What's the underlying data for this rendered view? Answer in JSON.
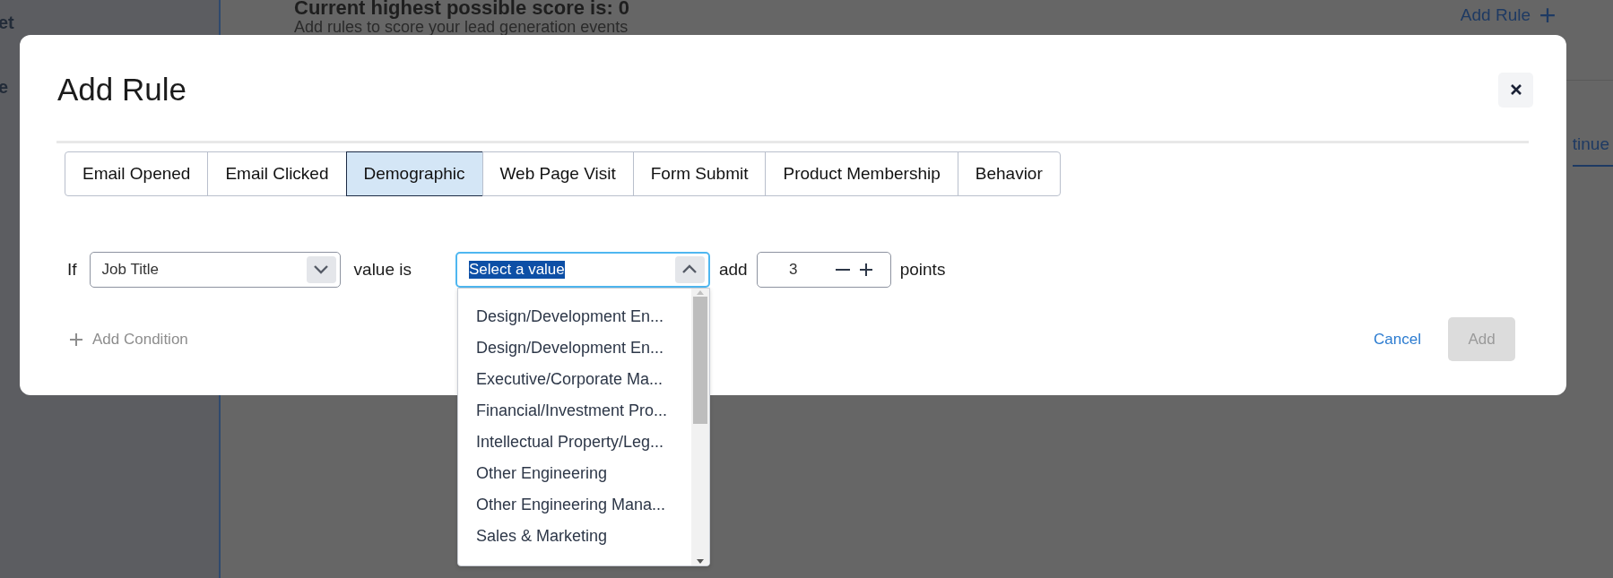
{
  "background": {
    "sidebar_items": [
      "et",
      "e"
    ],
    "heading": "Current highest possible score is: 0",
    "subheading": "Add rules to score your lead generation events",
    "add_rule_link": "Add Rule",
    "continue_button": "tinue"
  },
  "dialog": {
    "title": "Add Rule",
    "tabs": [
      {
        "label": "Email Opened",
        "selected": false
      },
      {
        "label": "Email Clicked",
        "selected": false
      },
      {
        "label": "Demographic",
        "selected": true
      },
      {
        "label": "Web Page Visit",
        "selected": false
      },
      {
        "label": "Form Submit",
        "selected": false
      },
      {
        "label": "Product Membership",
        "selected": false
      },
      {
        "label": "Behavior",
        "selected": false
      }
    ],
    "condition": {
      "if_label": "If",
      "field": {
        "value": "Job Title"
      },
      "operator_label": "value is",
      "value_select": {
        "value": "Select a value",
        "expanded": true,
        "options": [
          "Design/Development En...",
          "Design/Development En...",
          "Executive/Corporate Ma...",
          "Financial/Investment Pro...",
          "Intellectual Property/Leg...",
          "Other Engineering",
          "Other Engineering Mana...",
          "Sales & Marketing"
        ]
      },
      "add_label": "add",
      "points": {
        "value": "3"
      },
      "points_label": "points"
    },
    "add_condition": "Add Condition",
    "cancel": "Cancel",
    "add_button": {
      "label": "Add",
      "disabled": true
    }
  }
}
